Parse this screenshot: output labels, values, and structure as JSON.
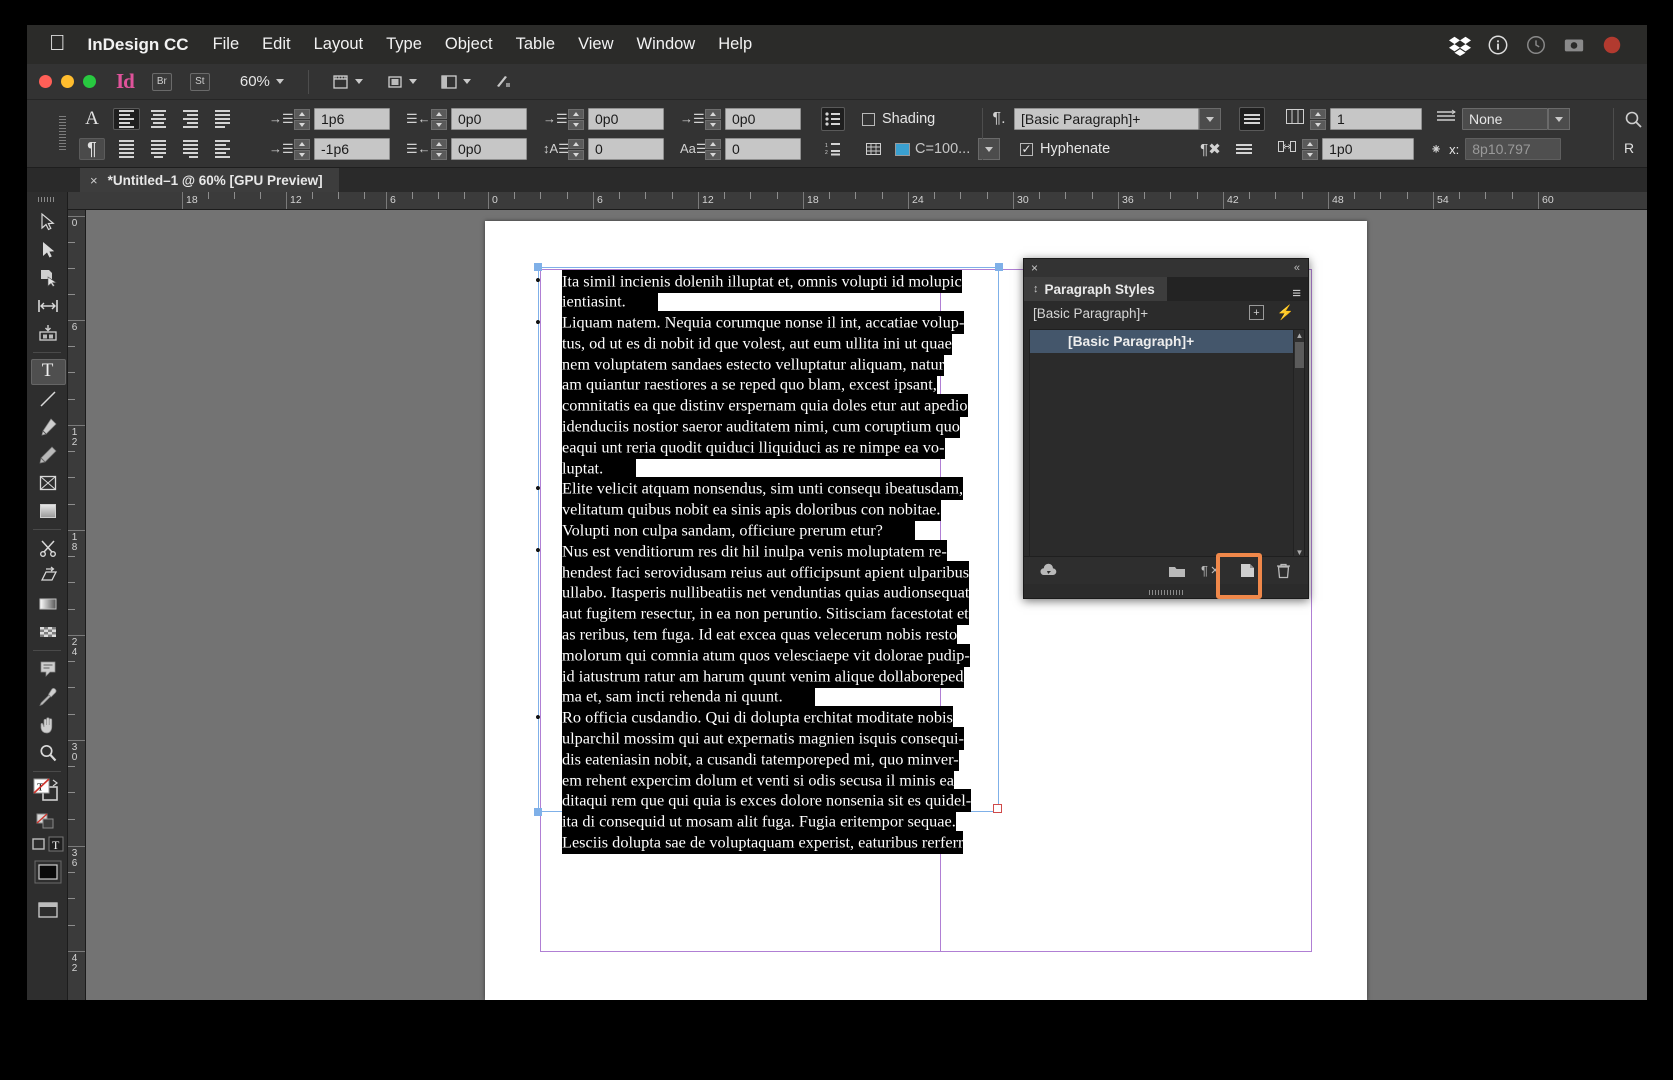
{
  "menubar": {
    "app_name": "InDesign CC",
    "items": [
      "File",
      "Edit",
      "Layout",
      "Type",
      "Object",
      "Table",
      "View",
      "Window",
      "Help"
    ],
    "right_icons": [
      "dropbox-icon",
      "info-icon",
      "clock-icon",
      "screenshot-icon",
      "record-icon"
    ]
  },
  "apptoolbar": {
    "bridge_label": "Br",
    "stock_label": "St",
    "zoom_level": "60%",
    "icons": [
      "view-options-icon",
      "screen-mode-icon",
      "arrange-documents-icon",
      "presentation-icon"
    ]
  },
  "control_panel": {
    "char_format_label": "A",
    "para_format_label": "¶",
    "align_buttons_row1": [
      "align-left",
      "align-center",
      "align-right",
      "justify-last-left"
    ],
    "align_buttons_row2": [
      "justify-all",
      "justify-center",
      "justify-right",
      "align-toward-spine"
    ],
    "left_indent": "1p6",
    "right_indent": "0p0",
    "first_line_indent": "-1p6",
    "last_line_indent": "0p0",
    "space_before": "0p0",
    "space_after": "0p0",
    "drop_cap_lines": "0",
    "drop_cap_chars": "0",
    "shading_label": "Shading",
    "shading_checked": false,
    "shading_color": "C=100...",
    "shading_color_hex": "#3aa0d0",
    "paragraph_style": "[Basic Paragraph]+",
    "hyphenate_label": "Hyphenate",
    "hyphenate_checked": true,
    "columns": "1",
    "gutter": "1p0",
    "grid_style": "None",
    "baseline_x": "8p10.797",
    "baseline_x_label": "x:"
  },
  "document_tab": {
    "close_glyph": "×",
    "title": "*Untitled–1 @ 60% [GPU Preview]"
  },
  "rulers": {
    "horizontal_labels": [
      "18",
      "12",
      "6",
      "0",
      "6",
      "12",
      "18",
      "24",
      "30",
      "36",
      "42",
      "48",
      "54",
      "60"
    ],
    "vertical_labels": [
      "0",
      "6",
      "12",
      "18",
      "24",
      "30",
      "36",
      "42"
    ],
    "units": "picas"
  },
  "tools": [
    {
      "name": "selection-tool",
      "icon": "arrow-outline"
    },
    {
      "name": "direct-selection-tool",
      "icon": "arrow-solid"
    },
    {
      "name": "page-tool",
      "icon": "page-arrow"
    },
    {
      "name": "gap-tool",
      "icon": "gap-arrows"
    },
    {
      "name": "content-collector-tool",
      "icon": "collector"
    },
    {
      "name": "type-tool",
      "icon": "letter-T",
      "selected": true
    },
    {
      "name": "line-tool",
      "icon": "diagonal-line"
    },
    {
      "name": "pen-tool",
      "icon": "pen-nib"
    },
    {
      "name": "pencil-tool",
      "icon": "pencil"
    },
    {
      "name": "rectangle-frame-tool",
      "icon": "frame-x"
    },
    {
      "name": "rectangle-tool",
      "icon": "square"
    },
    {
      "name": "scissors-tool",
      "icon": "scissors"
    },
    {
      "name": "free-transform-tool",
      "icon": "transform"
    },
    {
      "name": "gradient-swatch-tool",
      "icon": "gradient-bar"
    },
    {
      "name": "gradient-feather-tool",
      "icon": "checker"
    },
    {
      "name": "note-tool",
      "icon": "note"
    },
    {
      "name": "eyedropper-tool",
      "icon": "eyedropper"
    },
    {
      "name": "hand-tool",
      "icon": "hand"
    },
    {
      "name": "zoom-tool",
      "icon": "magnifier"
    }
  ],
  "paragraph_styles_panel": {
    "close_glyph": "×",
    "collapse_glyph": "«",
    "tab_title": "Paragraph Styles",
    "current_style": "[Basic Paragraph]+",
    "styles": [
      {
        "name": "[Basic Paragraph]+",
        "selected": true
      }
    ],
    "footer_icons": [
      "cloud-download-icon",
      "new-style-group-icon",
      "clear-overrides-icon",
      "new-style-icon",
      "delete-style-icon"
    ],
    "highlighted_footer_icon": "new-style-icon",
    "highlight_color": "#f0884a",
    "menu_glyph": "≡"
  },
  "document_text": {
    "paragraphs": [
      {
        "bullet": "•",
        "lines": [
          {
            "text": "Ita simil incienis dolenih illuptat et, omnis volupti id molupic",
            "selected": true
          },
          {
            "text": "ientiasint.",
            "selected": true,
            "trailing": true
          }
        ]
      },
      {
        "bullet": "•",
        "lines": [
          {
            "text": "Liquam natem. Nequia corumque nonse il int, accatiae volup-",
            "selected": true
          },
          {
            "text": "tus, od ut es di nobit id que volest, aut eum ullita ini ut quae",
            "selected": true
          },
          {
            "text": "nem voluptatem sandaes estecto velluptatur aliquam, natur",
            "selected": true
          },
          {
            "text": "am quiantur raestiores a se reped quo blam, excest ipsant,",
            "selected": true
          },
          {
            "text": "comnitatis ea que distinv erspernam quia doles etur aut apedio",
            "selected": true
          },
          {
            "text": "idenduciis nostior saeror auditatem nimi, cum coruptium quo",
            "selected": true
          },
          {
            "text": "eaqui unt reria quodit quiduci lliquiduci as re nimpe ea vo-",
            "selected": true
          },
          {
            "text": "luptat.",
            "selected": true,
            "trailing": true
          }
        ]
      },
      {
        "bullet": "•",
        "lines": [
          {
            "text": "Elite velicit atquam nonsendus, sim unti consequ ibeatusdam,",
            "selected": true
          },
          {
            "text": "velitatum quibus nobit ea sinis apis doloribus con nobitae.",
            "selected": true
          },
          {
            "text": "Volupti non culpa sandam, officiure prerum etur?",
            "selected": true,
            "trailing": true
          }
        ]
      },
      {
        "bullet": "•",
        "lines": [
          {
            "text": "Nus est venditiorum res dit hil inulpa venis moluptatem re-",
            "selected": true
          },
          {
            "text": "hendest faci serovidusam reius aut officipsunt apient ulparibus",
            "selected": true
          },
          {
            "text": "ullabo. Itasperis nullibeatiis net venduntias quias audionsequat",
            "selected": true
          },
          {
            "text": "aut fugitem resectur, in ea non peruntio. Sitisciam facestotat et",
            "selected": true
          },
          {
            "text": "as reribus, tem fuga. Id eat excea quas velecerum nobis resto",
            "selected": true
          },
          {
            "text": "molorum qui comnia atum quos velesciaepe vit dolorae pudip-",
            "selected": true
          },
          {
            "text": "id iatustrum ratur am harum quunt venim alique dollaboreped",
            "selected": true
          },
          {
            "text": "ma et, sam incti rehenda ni quunt.",
            "selected": true,
            "trailing": true
          }
        ]
      },
      {
        "bullet": "•",
        "lines": [
          {
            "text": "Ro officia cusdandio. Qui di dolupta erchitat moditate nobis",
            "selected": true
          },
          {
            "text": "ulparchil mossim qui aut expernatis magnien isquis consequi-",
            "selected": true
          },
          {
            "text": "dis eateniasin nobit, a cusandi tatemporeped mi, quo minver-",
            "selected": true
          },
          {
            "text": "em rehent expercim dolum et venti si odis secusa il minis ea",
            "selected": true
          },
          {
            "text": "ditaqui rem que qui quia is exces dolore nonsenia sit es quidel-",
            "selected": true
          },
          {
            "text": "ita di consequid ut mosam alit fuga. Fugia eritempor sequae.",
            "selected": true
          },
          {
            "text": "Lesciis dolupta sae de voluptaquam experist, eaturibus rerferr",
            "selected": true
          }
        ]
      }
    ]
  }
}
